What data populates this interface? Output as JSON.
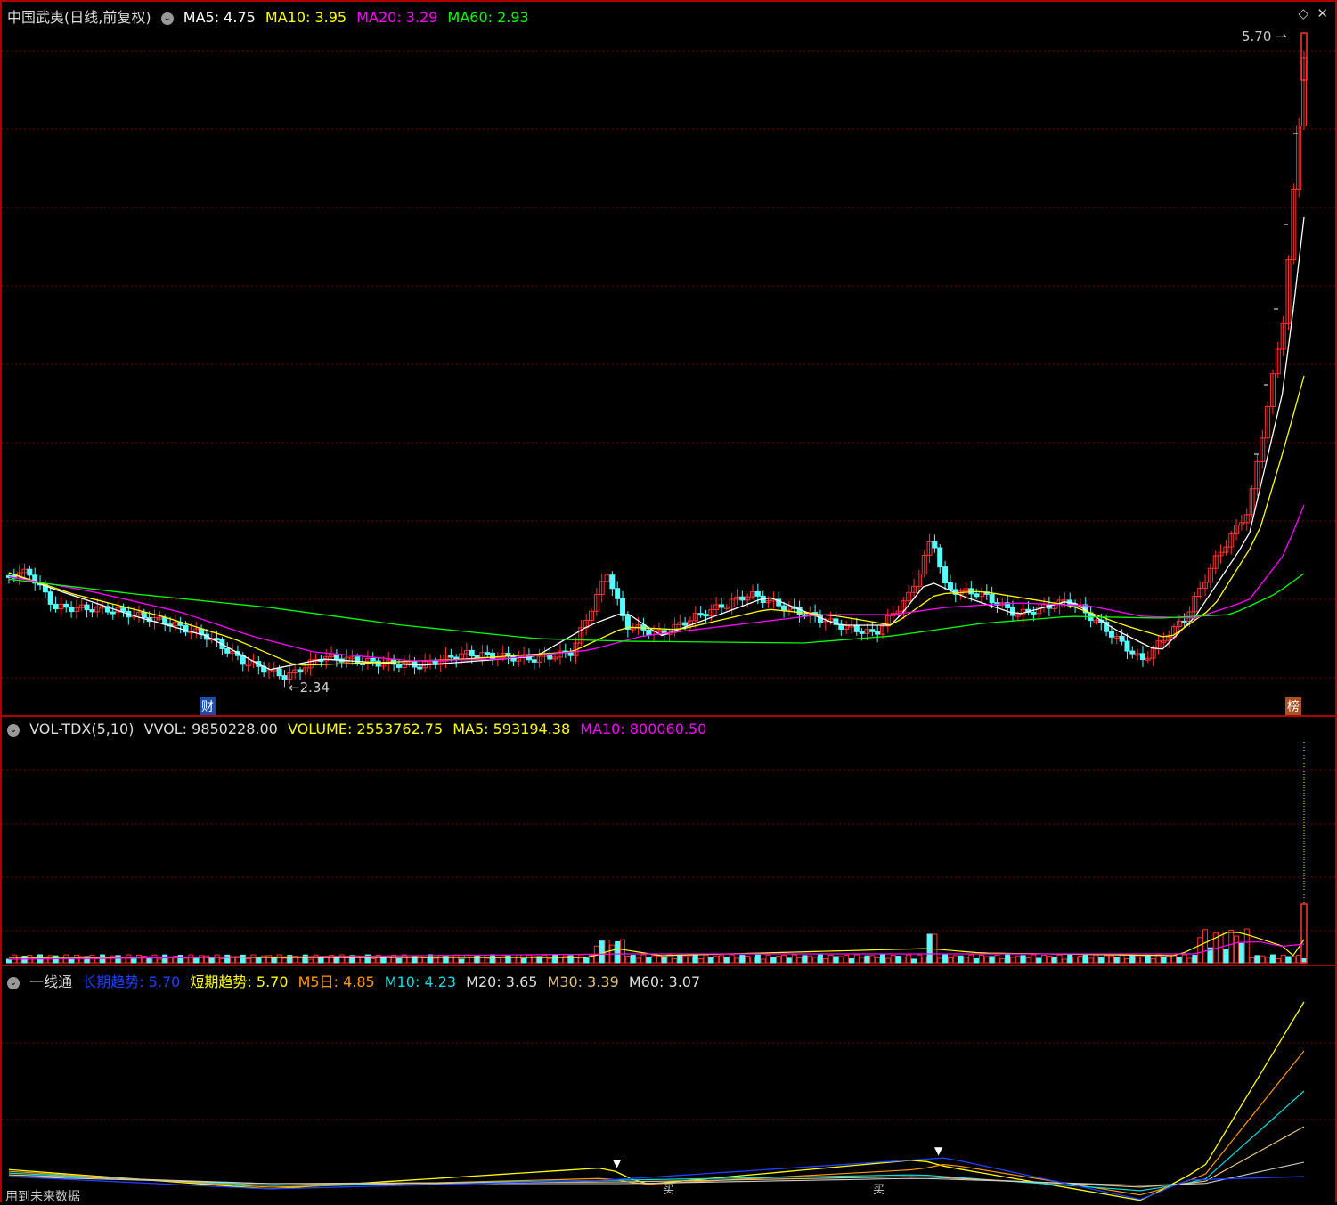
{
  "main": {
    "title": "中国武夷(日线,前复权)",
    "ma_labels": [
      {
        "name": "MA5",
        "value": "4.75",
        "color": "#ffffff"
      },
      {
        "name": "MA10",
        "value": "3.95",
        "color": "#ffff00"
      },
      {
        "name": "MA20",
        "value": "3.29",
        "color": "#ff00ff"
      },
      {
        "name": "MA60",
        "value": "2.93",
        "color": "#00ff00"
      }
    ],
    "high_label": "5.70",
    "low_label": "2.34",
    "badge_cai": "财",
    "badge_bang": "榜"
  },
  "volume": {
    "indicator": "VOL-TDX(5,10)",
    "vvol_label": "VVOL: 9850228.00",
    "volume_label": "VOLUME: 2553762.75",
    "ma5_label": "MA5: 593194.38",
    "ma10_label": "MA10: 800060.50"
  },
  "trend": {
    "indicator": "一线通",
    "long_trend": "长期趋势: 5.70",
    "short_trend": "短期趋势: 5.70",
    "m5": "M5日: 4.85",
    "m10": "M10: 4.23",
    "m20": "M20: 3.65",
    "m30": "M30: 3.39",
    "m60": "M60: 3.07",
    "buy_label": "买",
    "footer": "用到未来数据"
  },
  "colors": {
    "up": "#ff3232",
    "down": "#54ffff",
    "ma5": "#ffffff",
    "ma10": "#ffff00",
    "ma20": "#ff00ff",
    "ma60": "#00ff00",
    "grid": "#7a0000",
    "border": "#b00000"
  }
}
